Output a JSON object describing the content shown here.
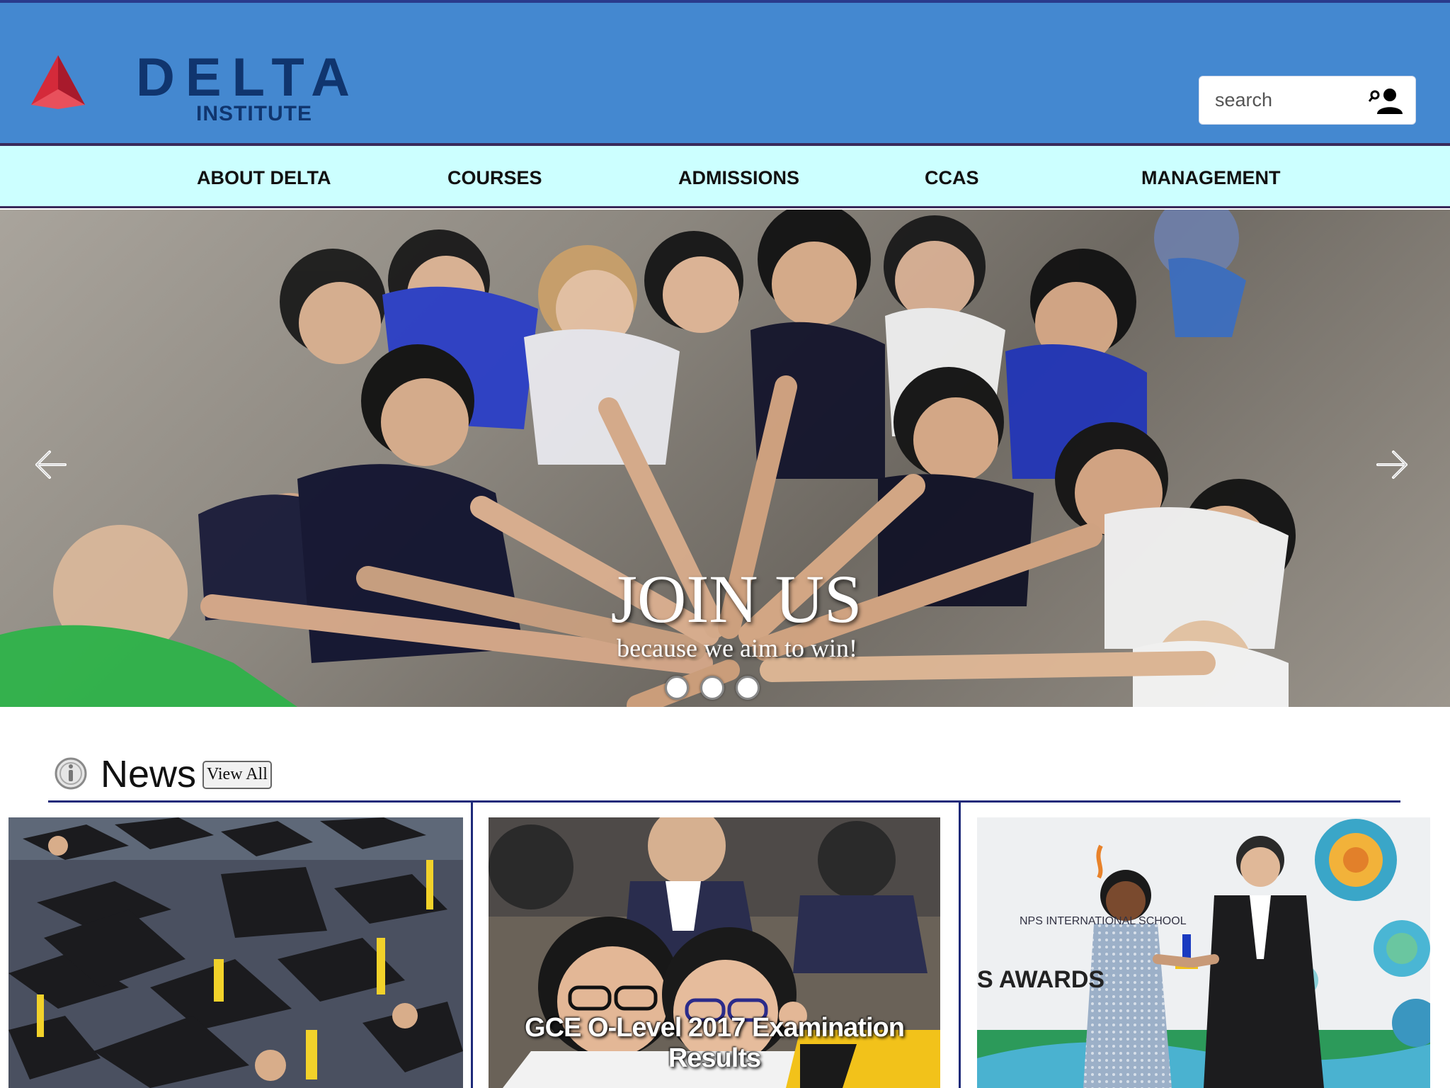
{
  "brand": {
    "name": "DELTA",
    "subtitle": "INSTITUTE",
    "logo_icon": "delta-triangle-logo",
    "colors": {
      "header_bg": "#4488d0",
      "nav_bg": "#ccffff",
      "logo_text": "#10356e",
      "logo_red": "#d42a3a",
      "rule": "#1e2a7a"
    }
  },
  "search": {
    "placeholder": "search",
    "icon": "user-search-icon"
  },
  "nav": {
    "items": [
      {
        "label": "ABOUT DELTA"
      },
      {
        "label": "COURSES"
      },
      {
        "label": "ADMISSIONS"
      },
      {
        "label": "CCAS"
      },
      {
        "label": "MANAGEMENT"
      }
    ]
  },
  "hero": {
    "title": "JOIN US",
    "subtitle": "because we aim to win!",
    "prev_icon": "arrow-left-icon",
    "next_icon": "arrow-right-icon",
    "slide_count": 3,
    "active_slide": 1
  },
  "news": {
    "title": "News",
    "icon": "info-icon",
    "view_all_label": "View All",
    "cards": [
      {
        "caption": ""
      },
      {
        "caption": "GCE O-Level 2017 Examination Results"
      },
      {
        "caption": "",
        "sign_line1": "NPS INTERNATIONAL SCHOOL",
        "sign_line2": "S AWARDS"
      }
    ]
  }
}
